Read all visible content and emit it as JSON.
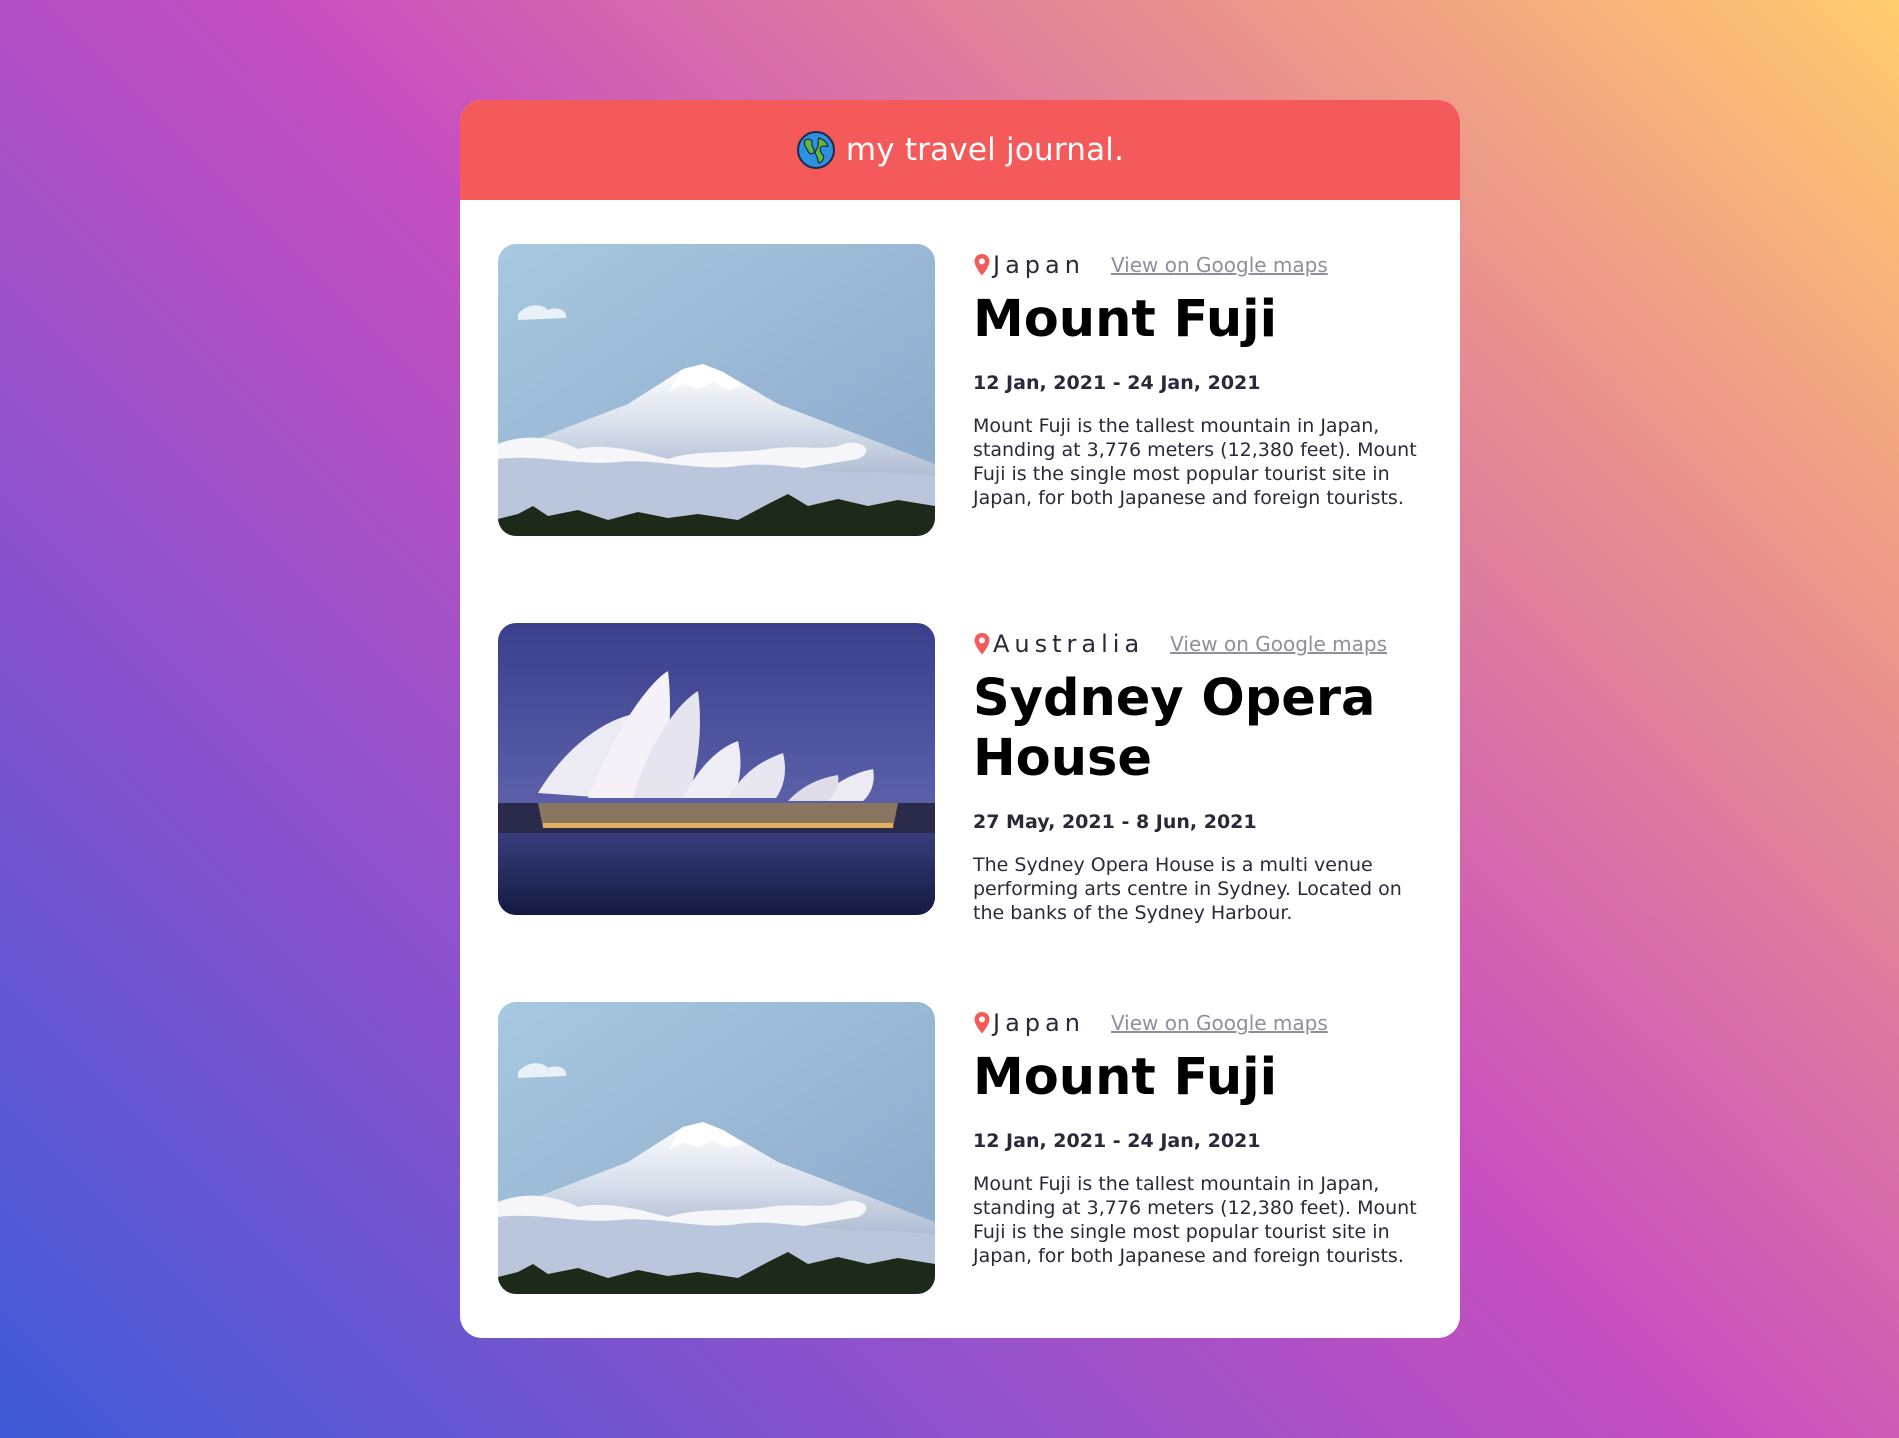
{
  "header": {
    "title": "my travel journal.",
    "icon": "globe-icon"
  },
  "colors": {
    "header_bg": "#f55a5a",
    "pin": "#f55a5a",
    "link": "#918e9b",
    "text": "#2b283a"
  },
  "entries": [
    {
      "country": "Japan",
      "maps_link": "View on Google maps",
      "place": "Mount Fuji",
      "dates": "12 Jan, 2021 - 24 Jan, 2021",
      "description": "Mount Fuji is the tallest mountain in Japan, standing at 3,776 meters (12,380 feet). Mount Fuji is the single most popular tourist site in Japan, for both Japanese and foreign tourists.",
      "image": "mount-fuji-photo"
    },
    {
      "country": "Australia",
      "maps_link": "View on Google maps",
      "place": "Sydney Opera House",
      "dates": "27 May, 2021 - 8 Jun, 2021",
      "description": "The Sydney Opera House is a multi venue performing arts centre in Sydney. Located on the banks of the Sydney Harbour.",
      "image": "sydney-opera-house-photo"
    },
    {
      "country": "Japan",
      "maps_link": "View on Google maps",
      "place": "Mount Fuji",
      "dates": "12 Jan, 2021 - 24 Jan, 2021",
      "description": "Mount Fuji is the tallest mountain in Japan, standing at 3,776 meters (12,380 feet). Mount Fuji is the single most popular tourist site in Japan, for both Japanese and foreign tourists.",
      "image": "mount-fuji-photo"
    }
  ]
}
